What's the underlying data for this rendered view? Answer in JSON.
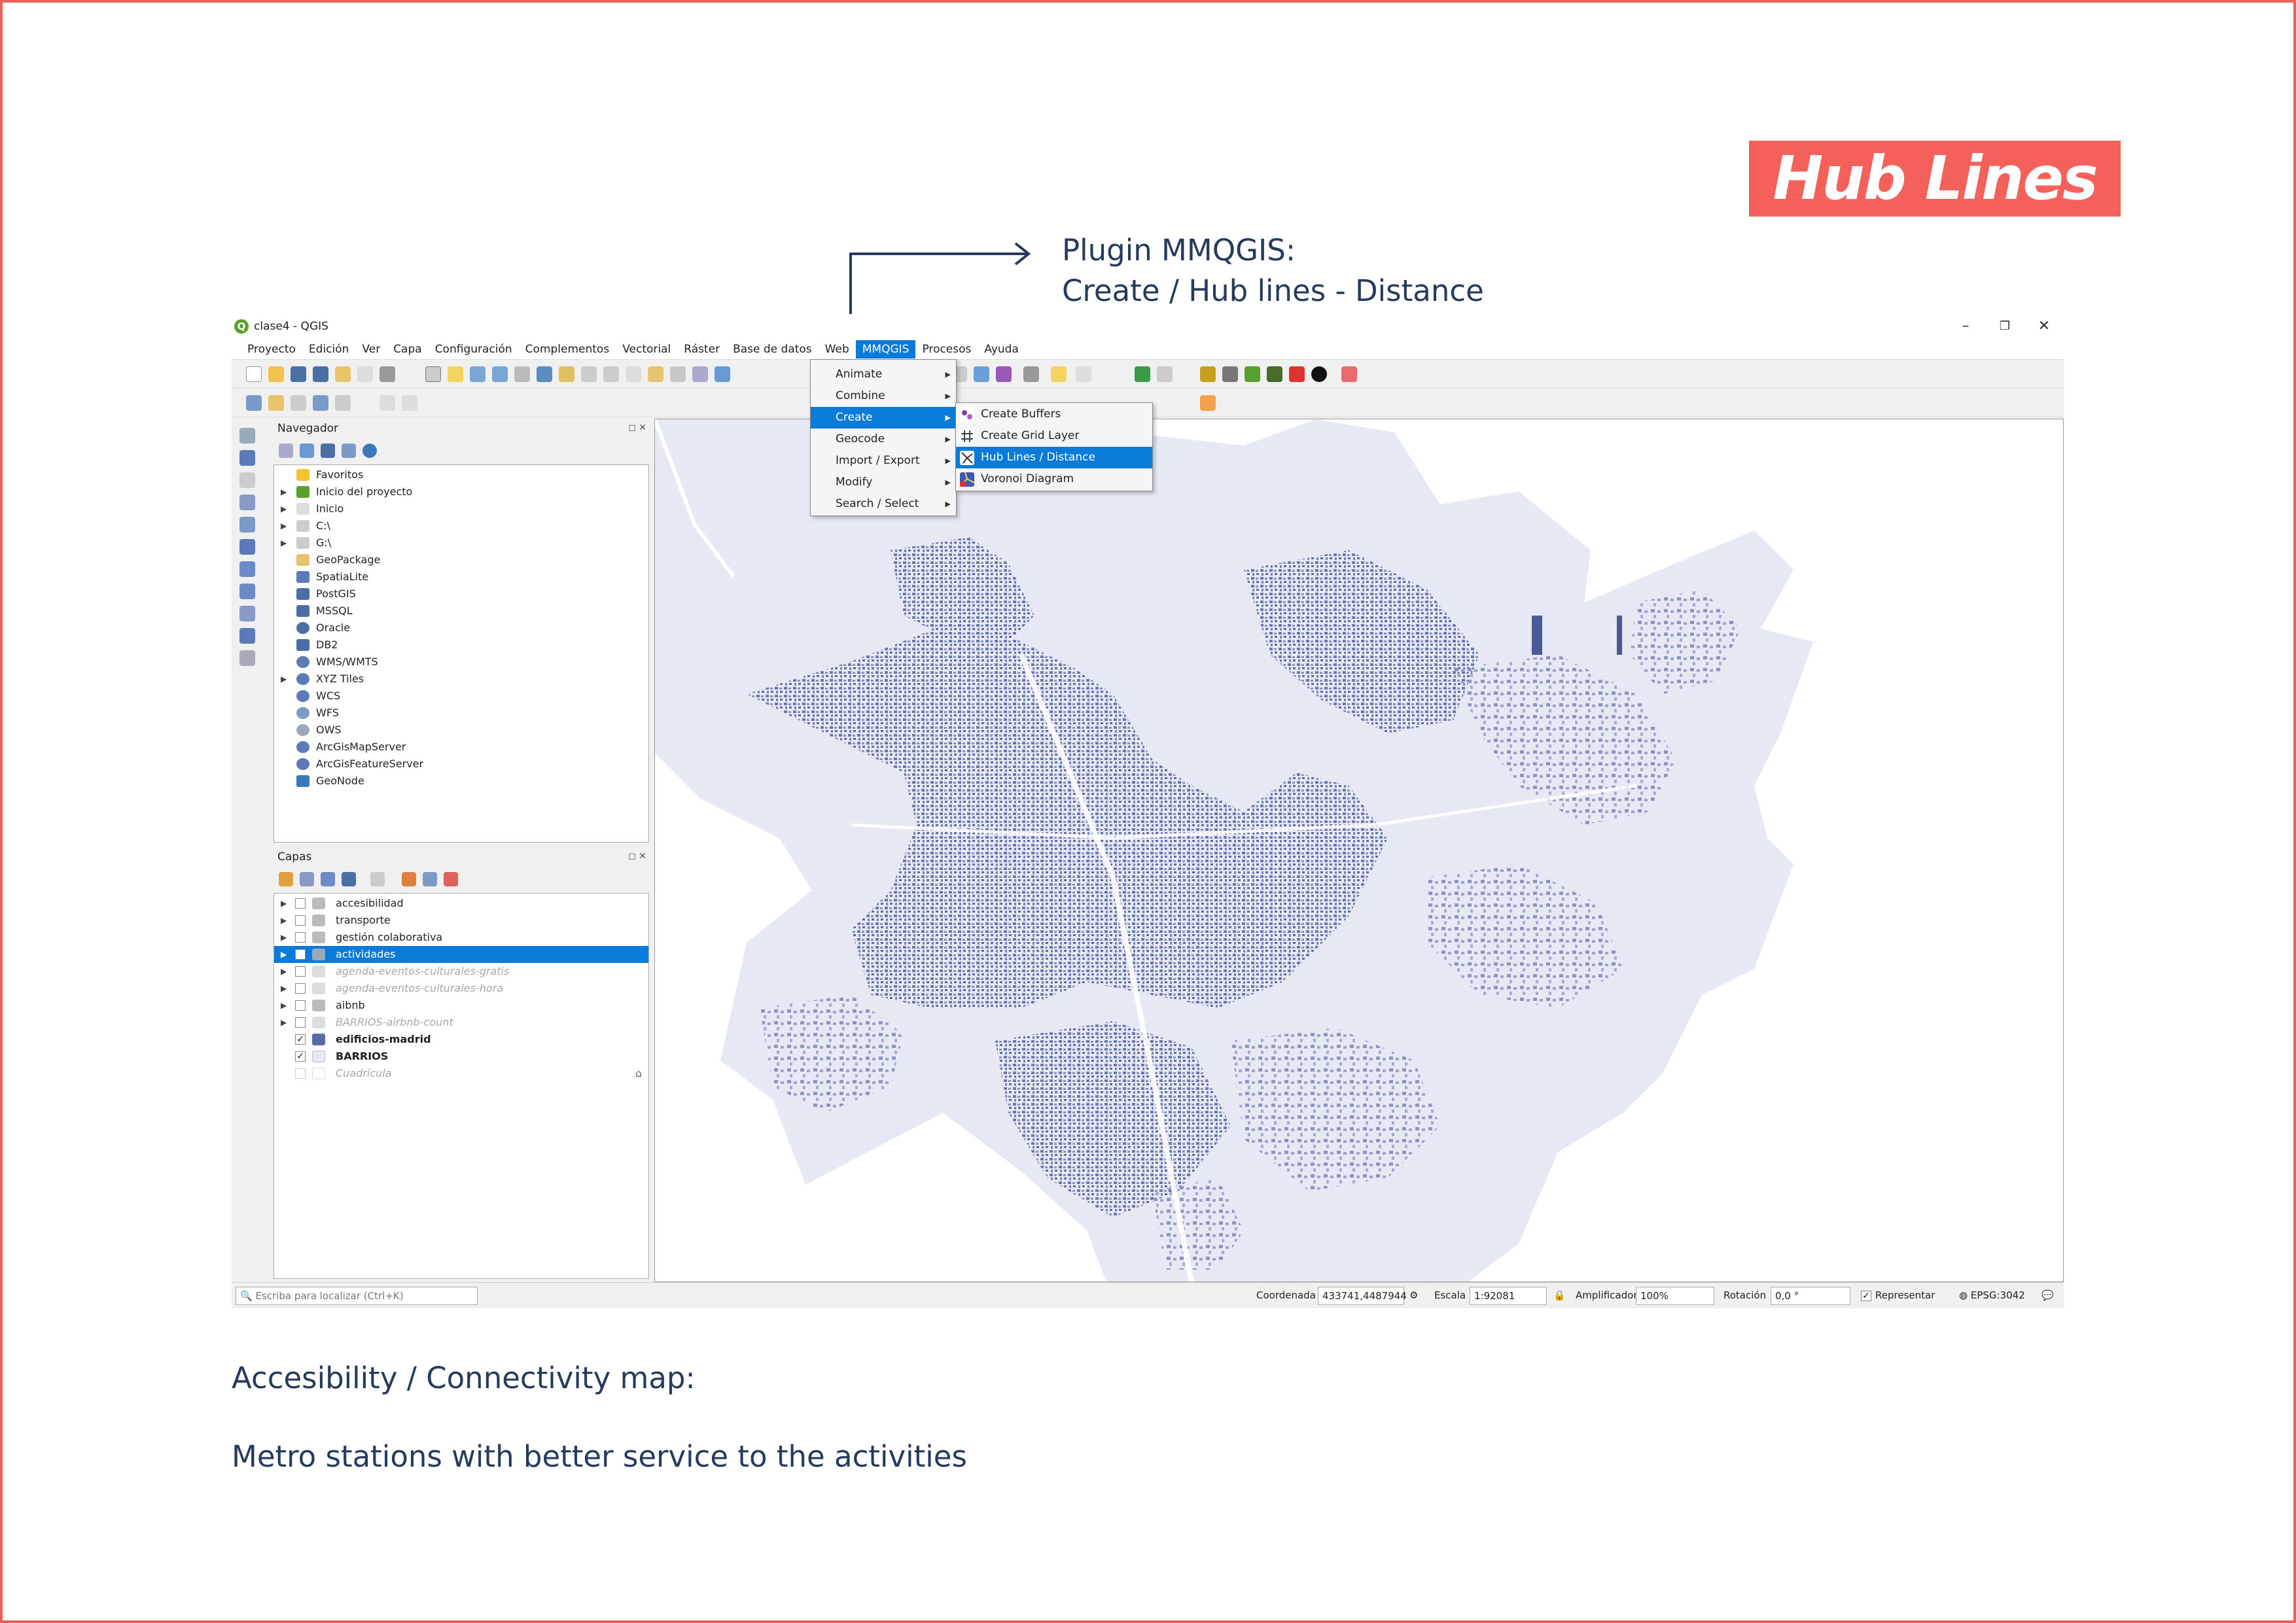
{
  "badge": {
    "title": "Hub Lines"
  },
  "annotation": {
    "line1": "Plugin MMQGIS:",
    "line2": "Create / Hub lines - Distance"
  },
  "captions": {
    "c1": "Accesibility / Connectivity map:",
    "c2": "Metro stations with better service to the activities"
  },
  "window": {
    "title": "clase4 - QGIS",
    "minimize": "–",
    "restore": "❐",
    "close": "✕"
  },
  "menubar": [
    "Proyecto",
    "Edición",
    "Ver",
    "Capa",
    "Configuración",
    "Complementos",
    "Vectorial",
    "Ráster",
    "Base de datos",
    "Web",
    "MMQGIS",
    "Procesos",
    "Ayuda"
  ],
  "mmqgis_menu": [
    "Animate",
    "Combine",
    "Create",
    "Geocode",
    "Import / Export",
    "Modify",
    "Search / Select"
  ],
  "create_menu": [
    "Create Buffers",
    "Create Grid Layer",
    "Hub Lines / Distance",
    "Voronoi Diagram"
  ],
  "browser": {
    "title": "Navegador",
    "items": [
      "Favoritos",
      "Inicio del proyecto",
      "Inicio",
      "C:\\",
      "G:\\",
      "GeoPackage",
      "SpatiaLite",
      "PostGIS",
      "MSSQL",
      "Oracle",
      "DB2",
      "WMS/WMTS",
      "XYZ Tiles",
      "WCS",
      "WFS",
      "OWS",
      "ArcGisMapServer",
      "ArcGisFeatureServer",
      "GeoNode"
    ]
  },
  "layers": {
    "title": "Capas",
    "items": [
      "accesibilidad",
      "transporte",
      "gestión colaborativa",
      "actividades",
      "agenda-eventos-culturales-gratis",
      "agenda-eventos-culturales-hora",
      "aibnb",
      "BARRIOS-airbnb-count",
      "edificios-madrid",
      "BARRIOS",
      "Cuadrícula"
    ],
    "checked": [
      false,
      false,
      false,
      false,
      false,
      false,
      false,
      false,
      true,
      true,
      false
    ]
  },
  "status": {
    "search_placeholder": "Escriba para localizar (Ctrl+K)",
    "coord_label": "Coordenada",
    "coord_value": "433741,4487944",
    "scale_label": "Escala",
    "scale_value": "1:92081",
    "magnifier_label": "Amplificador",
    "magnifier_value": "100%",
    "rotation_label": "Rotación",
    "rotation_value": "0,0 °",
    "render_label": "Representar",
    "crs": "EPSG:3042"
  },
  "colors": {
    "accent": "#f4605a",
    "selection": "#0a7bd8",
    "map_fill": "#e6e9f4",
    "map_buildings": "#5a6aa6",
    "text_dark": "#263a5e"
  }
}
